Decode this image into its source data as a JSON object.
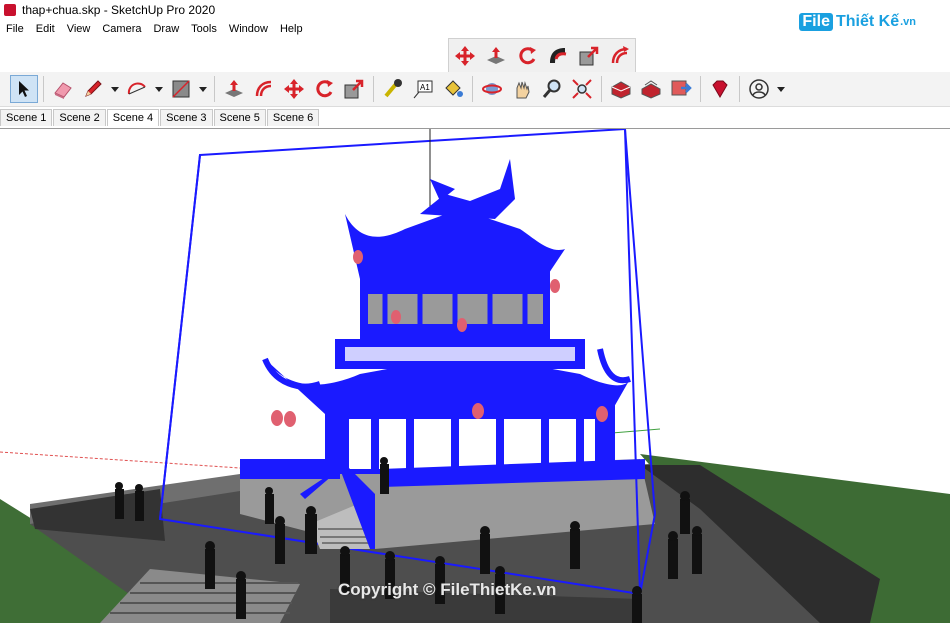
{
  "window": {
    "title": "thap+chua.skp - SketchUp Pro 2020"
  },
  "watermark": {
    "box": "File",
    "rest": "Thiết Kế",
    "tld": ".vn",
    "copyright": "Copyright © FileThietKe.vn"
  },
  "menu": [
    "File",
    "Edit",
    "View",
    "Camera",
    "Draw",
    "Tools",
    "Window",
    "Help"
  ],
  "scenes": [
    "Scene 1",
    "Scene 2",
    "Scene 4",
    "Scene 3",
    "Scene 5",
    "Scene 6"
  ],
  "active_scene": "Scene 4",
  "colors": {
    "selection_blue": "#1a1aff",
    "grass": "#3d6b34",
    "pavement": "#555555",
    "accent_red": "#c8102e"
  },
  "icons": {
    "floating_toolbar": [
      "move-icon",
      "push-pull-icon",
      "rotate-icon",
      "follow-me-icon",
      "scale-icon",
      "offset-icon"
    ],
    "main_toolbar": [
      "select-icon",
      "eraser-icon",
      "pencil-icon",
      "arc-icon",
      "rectangle-icon",
      "push-pull-icon",
      "offset-icon",
      "move-icon",
      "rotate-icon",
      "scale-icon",
      "tape-measure-icon",
      "text-icon",
      "paint-bucket-icon",
      "orbit-icon",
      "pan-icon",
      "zoom-icon",
      "zoom-extents-icon",
      "warehouse-icon",
      "extension-warehouse-icon",
      "layout-icon",
      "ruby-icon",
      "account-icon"
    ]
  }
}
